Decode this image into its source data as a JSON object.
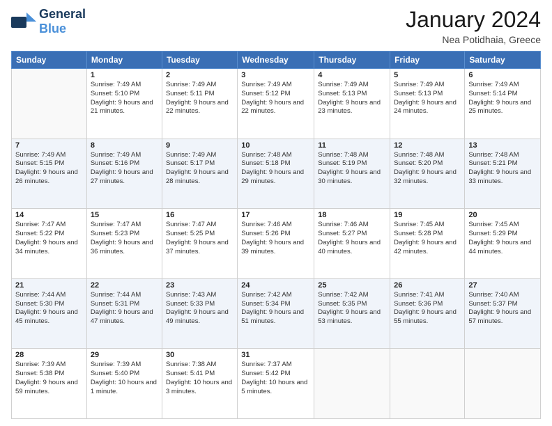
{
  "header": {
    "logo_line1": "General",
    "logo_line2": "Blue",
    "month_title": "January 2024",
    "location": "Nea Potidhaia, Greece"
  },
  "weekdays": [
    "Sunday",
    "Monday",
    "Tuesday",
    "Wednesday",
    "Thursday",
    "Friday",
    "Saturday"
  ],
  "weeks": [
    [
      {
        "day": "",
        "sunrise": "",
        "sunset": "",
        "daylight": ""
      },
      {
        "day": "1",
        "sunrise": "Sunrise: 7:49 AM",
        "sunset": "Sunset: 5:10 PM",
        "daylight": "Daylight: 9 hours and 21 minutes."
      },
      {
        "day": "2",
        "sunrise": "Sunrise: 7:49 AM",
        "sunset": "Sunset: 5:11 PM",
        "daylight": "Daylight: 9 hours and 22 minutes."
      },
      {
        "day": "3",
        "sunrise": "Sunrise: 7:49 AM",
        "sunset": "Sunset: 5:12 PM",
        "daylight": "Daylight: 9 hours and 22 minutes."
      },
      {
        "day": "4",
        "sunrise": "Sunrise: 7:49 AM",
        "sunset": "Sunset: 5:13 PM",
        "daylight": "Daylight: 9 hours and 23 minutes."
      },
      {
        "day": "5",
        "sunrise": "Sunrise: 7:49 AM",
        "sunset": "Sunset: 5:13 PM",
        "daylight": "Daylight: 9 hours and 24 minutes."
      },
      {
        "day": "6",
        "sunrise": "Sunrise: 7:49 AM",
        "sunset": "Sunset: 5:14 PM",
        "daylight": "Daylight: 9 hours and 25 minutes."
      }
    ],
    [
      {
        "day": "7",
        "sunrise": "Sunrise: 7:49 AM",
        "sunset": "Sunset: 5:15 PM",
        "daylight": "Daylight: 9 hours and 26 minutes."
      },
      {
        "day": "8",
        "sunrise": "Sunrise: 7:49 AM",
        "sunset": "Sunset: 5:16 PM",
        "daylight": "Daylight: 9 hours and 27 minutes."
      },
      {
        "day": "9",
        "sunrise": "Sunrise: 7:49 AM",
        "sunset": "Sunset: 5:17 PM",
        "daylight": "Daylight: 9 hours and 28 minutes."
      },
      {
        "day": "10",
        "sunrise": "Sunrise: 7:48 AM",
        "sunset": "Sunset: 5:18 PM",
        "daylight": "Daylight: 9 hours and 29 minutes."
      },
      {
        "day": "11",
        "sunrise": "Sunrise: 7:48 AM",
        "sunset": "Sunset: 5:19 PM",
        "daylight": "Daylight: 9 hours and 30 minutes."
      },
      {
        "day": "12",
        "sunrise": "Sunrise: 7:48 AM",
        "sunset": "Sunset: 5:20 PM",
        "daylight": "Daylight: 9 hours and 32 minutes."
      },
      {
        "day": "13",
        "sunrise": "Sunrise: 7:48 AM",
        "sunset": "Sunset: 5:21 PM",
        "daylight": "Daylight: 9 hours and 33 minutes."
      }
    ],
    [
      {
        "day": "14",
        "sunrise": "Sunrise: 7:47 AM",
        "sunset": "Sunset: 5:22 PM",
        "daylight": "Daylight: 9 hours and 34 minutes."
      },
      {
        "day": "15",
        "sunrise": "Sunrise: 7:47 AM",
        "sunset": "Sunset: 5:23 PM",
        "daylight": "Daylight: 9 hours and 36 minutes."
      },
      {
        "day": "16",
        "sunrise": "Sunrise: 7:47 AM",
        "sunset": "Sunset: 5:25 PM",
        "daylight": "Daylight: 9 hours and 37 minutes."
      },
      {
        "day": "17",
        "sunrise": "Sunrise: 7:46 AM",
        "sunset": "Sunset: 5:26 PM",
        "daylight": "Daylight: 9 hours and 39 minutes."
      },
      {
        "day": "18",
        "sunrise": "Sunrise: 7:46 AM",
        "sunset": "Sunset: 5:27 PM",
        "daylight": "Daylight: 9 hours and 40 minutes."
      },
      {
        "day": "19",
        "sunrise": "Sunrise: 7:45 AM",
        "sunset": "Sunset: 5:28 PM",
        "daylight": "Daylight: 9 hours and 42 minutes."
      },
      {
        "day": "20",
        "sunrise": "Sunrise: 7:45 AM",
        "sunset": "Sunset: 5:29 PM",
        "daylight": "Daylight: 9 hours and 44 minutes."
      }
    ],
    [
      {
        "day": "21",
        "sunrise": "Sunrise: 7:44 AM",
        "sunset": "Sunset: 5:30 PM",
        "daylight": "Daylight: 9 hours and 45 minutes."
      },
      {
        "day": "22",
        "sunrise": "Sunrise: 7:44 AM",
        "sunset": "Sunset: 5:31 PM",
        "daylight": "Daylight: 9 hours and 47 minutes."
      },
      {
        "day": "23",
        "sunrise": "Sunrise: 7:43 AM",
        "sunset": "Sunset: 5:33 PM",
        "daylight": "Daylight: 9 hours and 49 minutes."
      },
      {
        "day": "24",
        "sunrise": "Sunrise: 7:42 AM",
        "sunset": "Sunset: 5:34 PM",
        "daylight": "Daylight: 9 hours and 51 minutes."
      },
      {
        "day": "25",
        "sunrise": "Sunrise: 7:42 AM",
        "sunset": "Sunset: 5:35 PM",
        "daylight": "Daylight: 9 hours and 53 minutes."
      },
      {
        "day": "26",
        "sunrise": "Sunrise: 7:41 AM",
        "sunset": "Sunset: 5:36 PM",
        "daylight": "Daylight: 9 hours and 55 minutes."
      },
      {
        "day": "27",
        "sunrise": "Sunrise: 7:40 AM",
        "sunset": "Sunset: 5:37 PM",
        "daylight": "Daylight: 9 hours and 57 minutes."
      }
    ],
    [
      {
        "day": "28",
        "sunrise": "Sunrise: 7:39 AM",
        "sunset": "Sunset: 5:38 PM",
        "daylight": "Daylight: 9 hours and 59 minutes."
      },
      {
        "day": "29",
        "sunrise": "Sunrise: 7:39 AM",
        "sunset": "Sunset: 5:40 PM",
        "daylight": "Daylight: 10 hours and 1 minute."
      },
      {
        "day": "30",
        "sunrise": "Sunrise: 7:38 AM",
        "sunset": "Sunset: 5:41 PM",
        "daylight": "Daylight: 10 hours and 3 minutes."
      },
      {
        "day": "31",
        "sunrise": "Sunrise: 7:37 AM",
        "sunset": "Sunset: 5:42 PM",
        "daylight": "Daylight: 10 hours and 5 minutes."
      },
      {
        "day": "",
        "sunrise": "",
        "sunset": "",
        "daylight": ""
      },
      {
        "day": "",
        "sunrise": "",
        "sunset": "",
        "daylight": ""
      },
      {
        "day": "",
        "sunrise": "",
        "sunset": "",
        "daylight": ""
      }
    ]
  ]
}
